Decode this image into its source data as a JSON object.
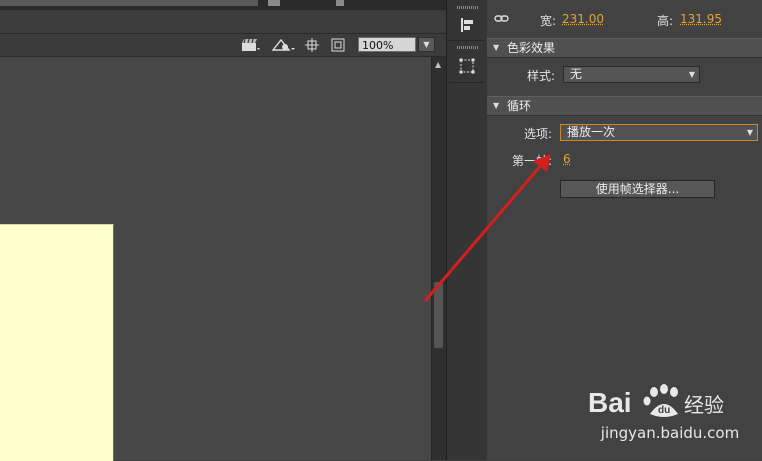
{
  "stage": {
    "zoom_value": "100%",
    "toolbar_icons": [
      "clapperboard-icon",
      "symbol-icon",
      "crosshair-icon",
      "clip-icon"
    ]
  },
  "panel": {
    "size": {
      "width_label": "宽:",
      "width_value": "231.00",
      "height_label": "高:",
      "height_value": "131.95"
    },
    "color_effect": {
      "title": "色彩效果",
      "style_label": "样式:",
      "style_value": "无"
    },
    "loop": {
      "title": "循环",
      "options_label": "选项:",
      "options_value": "播放一次",
      "first_frame_label": "第一帧:",
      "first_frame_value": "6",
      "frame_picker_button": "使用帧选择器..."
    }
  },
  "watermark": {
    "logo_text": "Bai du 经验",
    "url": "jingyan.baidu.com"
  },
  "colors": {
    "accent_value": "#e0a33a",
    "arrow": "#d41f1f",
    "canvas": "#ffffcc"
  }
}
